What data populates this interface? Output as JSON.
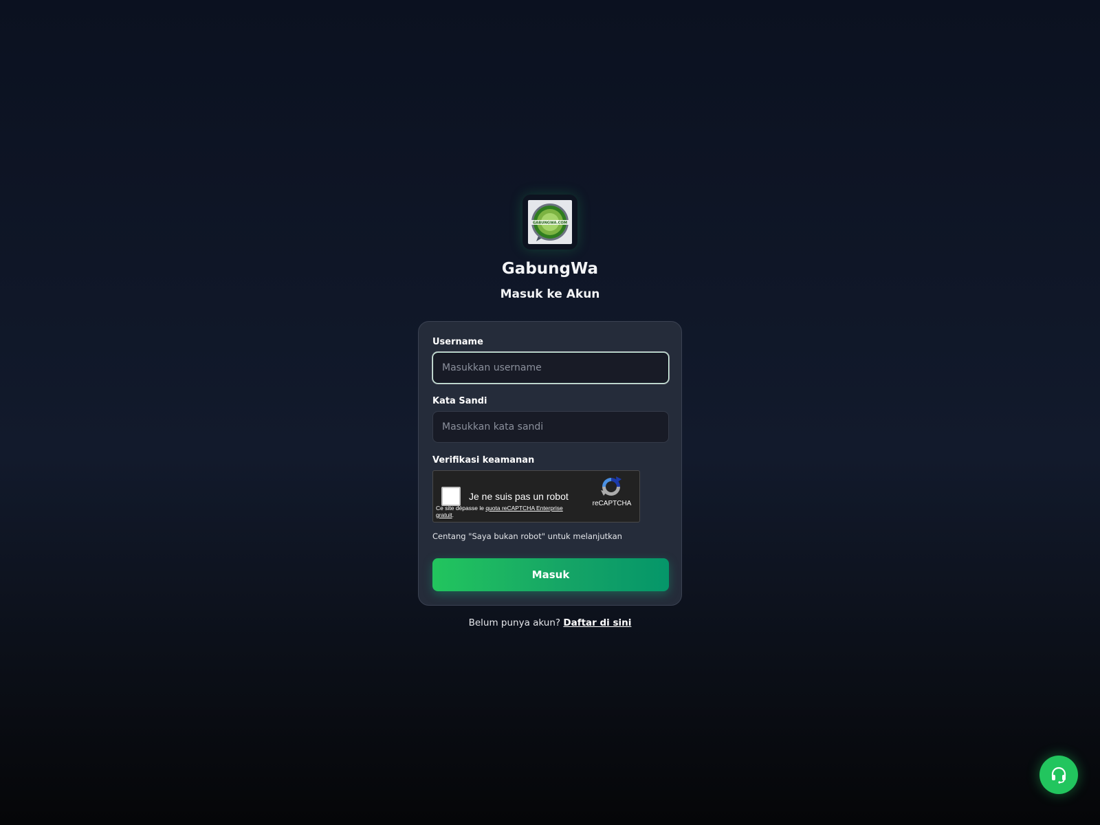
{
  "app": {
    "name": "GabungWa",
    "subtitle": "Masuk ke Akun",
    "logo_text": "GABUNGWA.COM"
  },
  "form": {
    "username_label": "Username",
    "username_placeholder": "Masukkan username",
    "username_value": "",
    "password_label": "Kata Sandi",
    "password_placeholder": "Masukkan kata sandi",
    "password_value": "",
    "verification_label": "Verifikasi keamanan",
    "recaptcha": {
      "checkbox_label": "Je ne suis pas un robot",
      "brand": "reCAPTCHA",
      "quota_text": "Ce site dépasse le",
      "quota_link": "quota reCAPTCHA Enterprise gratuit",
      "quota_suffix": ".",
      "checked": false
    },
    "hint": "Centang \"Saya bukan robot\" untuk melanjutkan",
    "submit_label": "Masuk"
  },
  "signup": {
    "prompt": "Belum punya akun?",
    "link_label": "Daftar di sini"
  },
  "support": {
    "icon": "headset-icon"
  },
  "colors": {
    "accent": "#22c55e",
    "accent_dark": "#059669",
    "card_bg": "#252c3a",
    "input_bg": "#181b26"
  }
}
